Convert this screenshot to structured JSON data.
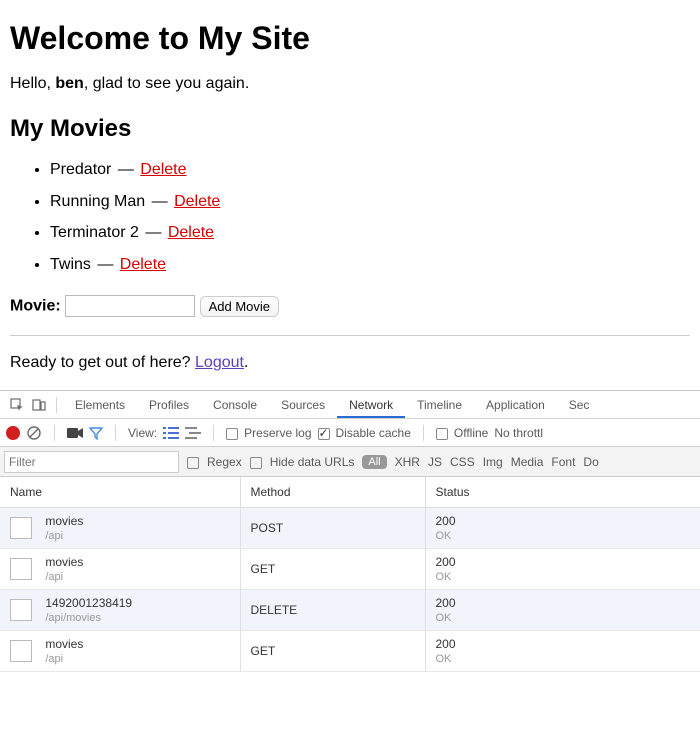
{
  "page": {
    "heading": "Welcome to My Site",
    "greeting_prefix": "Hello, ",
    "username": "ben",
    "greeting_suffix": ", glad to see you again.",
    "movies_heading": "My Movies",
    "movies": [
      {
        "title": "Predator",
        "delete_label": "Delete"
      },
      {
        "title": "Running Man",
        "delete_label": "Delete"
      },
      {
        "title": "Terminator 2",
        "delete_label": "Delete"
      },
      {
        "title": "Twins",
        "delete_label": "Delete"
      }
    ],
    "separator": " — ",
    "form": {
      "label": "Movie:",
      "input_value": "",
      "add_button": "Add Movie"
    },
    "logout_prompt": "Ready to get out of here? ",
    "logout_link": "Logout",
    "logout_period": "."
  },
  "devtools": {
    "tabs": [
      "Elements",
      "Profiles",
      "Console",
      "Sources",
      "Network",
      "Timeline",
      "Application",
      "Sec"
    ],
    "active_tab": "Network",
    "toolbar": {
      "view_label": "View:",
      "preserve_log": {
        "label": "Preserve log",
        "checked": false
      },
      "disable_cache": {
        "label": "Disable cache",
        "checked": true
      },
      "offline": {
        "label": "Offline",
        "checked": false
      },
      "throttle": "No throttl"
    },
    "filterbar": {
      "filter_placeholder": "Filter",
      "regex": {
        "label": "Regex",
        "checked": false
      },
      "hide_data_urls": {
        "label": "Hide data URLs",
        "checked": false
      },
      "active_type": "All",
      "types": [
        "XHR",
        "JS",
        "CSS",
        "Img",
        "Media",
        "Font",
        "Do"
      ]
    },
    "columns": {
      "name": "Name",
      "method": "Method",
      "status": "Status"
    },
    "requests": [
      {
        "name": "movies",
        "path": "/api",
        "method": "POST",
        "status_code": "200",
        "status_text": "OK"
      },
      {
        "name": "movies",
        "path": "/api",
        "method": "GET",
        "status_code": "200",
        "status_text": "OK"
      },
      {
        "name": "1492001238419",
        "path": "/api/movies",
        "method": "DELETE",
        "status_code": "200",
        "status_text": "OK"
      },
      {
        "name": "movies",
        "path": "/api",
        "method": "GET",
        "status_code": "200",
        "status_text": "OK"
      }
    ]
  }
}
